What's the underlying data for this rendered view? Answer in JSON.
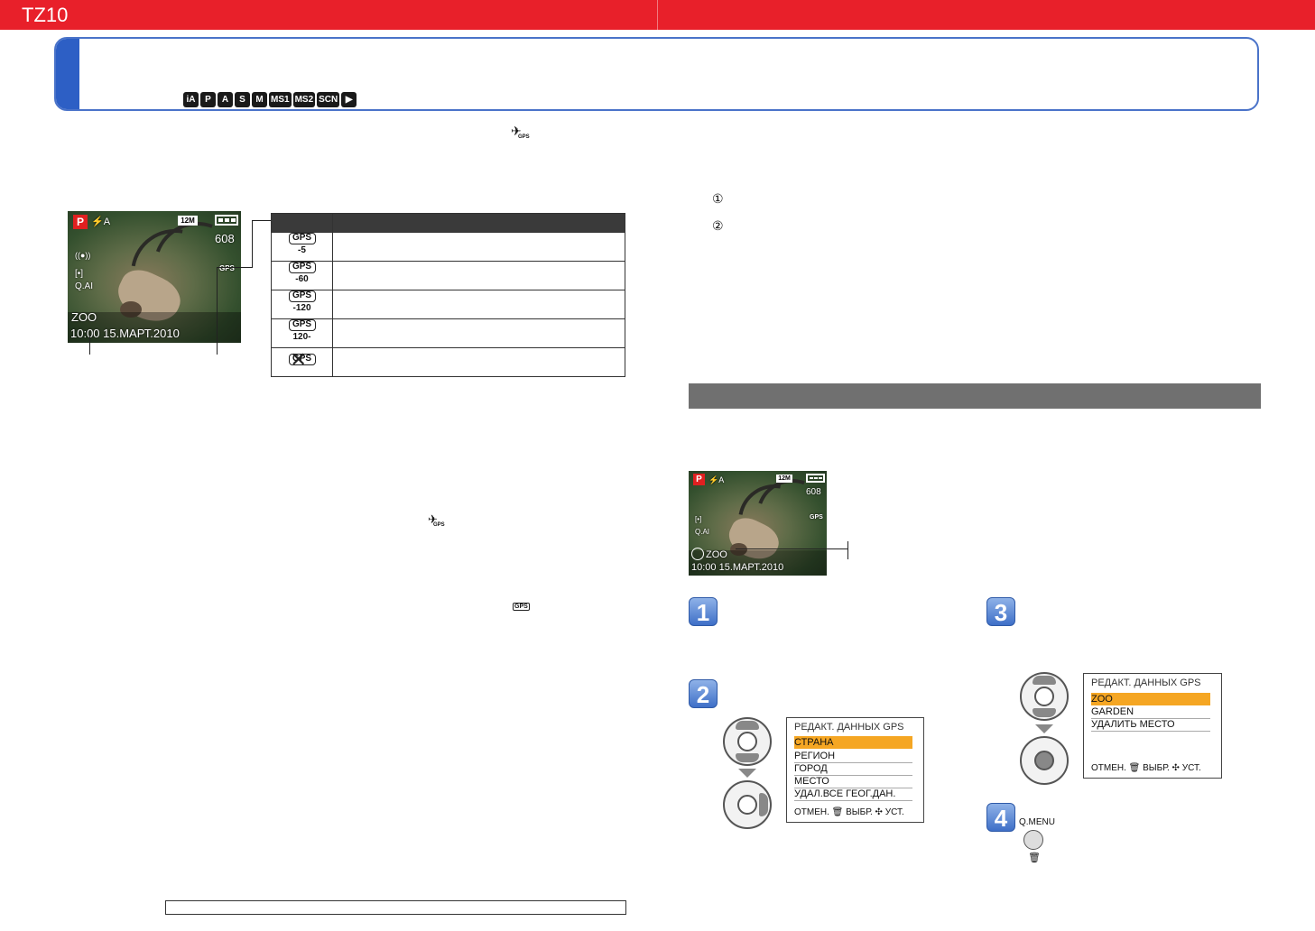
{
  "header": {
    "brand": "TZ10"
  },
  "modes": [
    "iA",
    "P",
    "A",
    "S",
    "M",
    "MS1",
    "MS2",
    "SCN",
    "▶"
  ],
  "camera_main": {
    "mode": "P",
    "flash": "⚡A",
    "size": "12M",
    "count": "608",
    "iso": "Q.AI",
    "ois": "((●))",
    "place": "ZOO",
    "datetime": "10:00 15.МАРТ.2010",
    "gps_badge": "GPS"
  },
  "gps_table": {
    "icons": [
      {
        "top": "GPS",
        "bottom": "-5"
      },
      {
        "top": "GPS",
        "bottom": "-60"
      },
      {
        "top": "GPS",
        "bottom": "-120"
      },
      {
        "top": "GPS",
        "bottom": "120-"
      },
      {
        "top": "GPS",
        "bottom": "✕"
      }
    ]
  },
  "inline_icons": {
    "plane_gps": "✈",
    "gps_small": "GPS"
  },
  "list_markers": [
    "①",
    "②"
  ],
  "camera_small": {
    "mode": "P",
    "flash": "⚡A",
    "size": "12M",
    "count": "608",
    "iso": "Q.AI",
    "place": "ZOO",
    "datetime": "10:00 15.МАРТ.2010",
    "gps_badge": "GPS"
  },
  "steps": [
    "1",
    "2",
    "3",
    "4"
  ],
  "menu_left": {
    "title": "РЕДАКТ. ДАННЫХ GPS",
    "items": [
      "СТРАНА",
      "РЕГИОН",
      "ГОРОД",
      "МЕСТО",
      "УДАЛ.ВСЕ ГЕОГ.ДАН."
    ],
    "footer": "ОТМЕН. 🗑 ВЫБР. ✣ УСТ."
  },
  "menu_right": {
    "title": "РЕДАКТ. ДАННЫХ GPS",
    "items": [
      "ZOO",
      "GARDEN",
      "УДАЛИТЬ МЕСТО"
    ],
    "footer": "ОТМЕН. 🗑 ВЫБР. ✣ УСТ."
  },
  "qmenu": {
    "label": "Q.MENU",
    "trash_icon": "🗑"
  }
}
